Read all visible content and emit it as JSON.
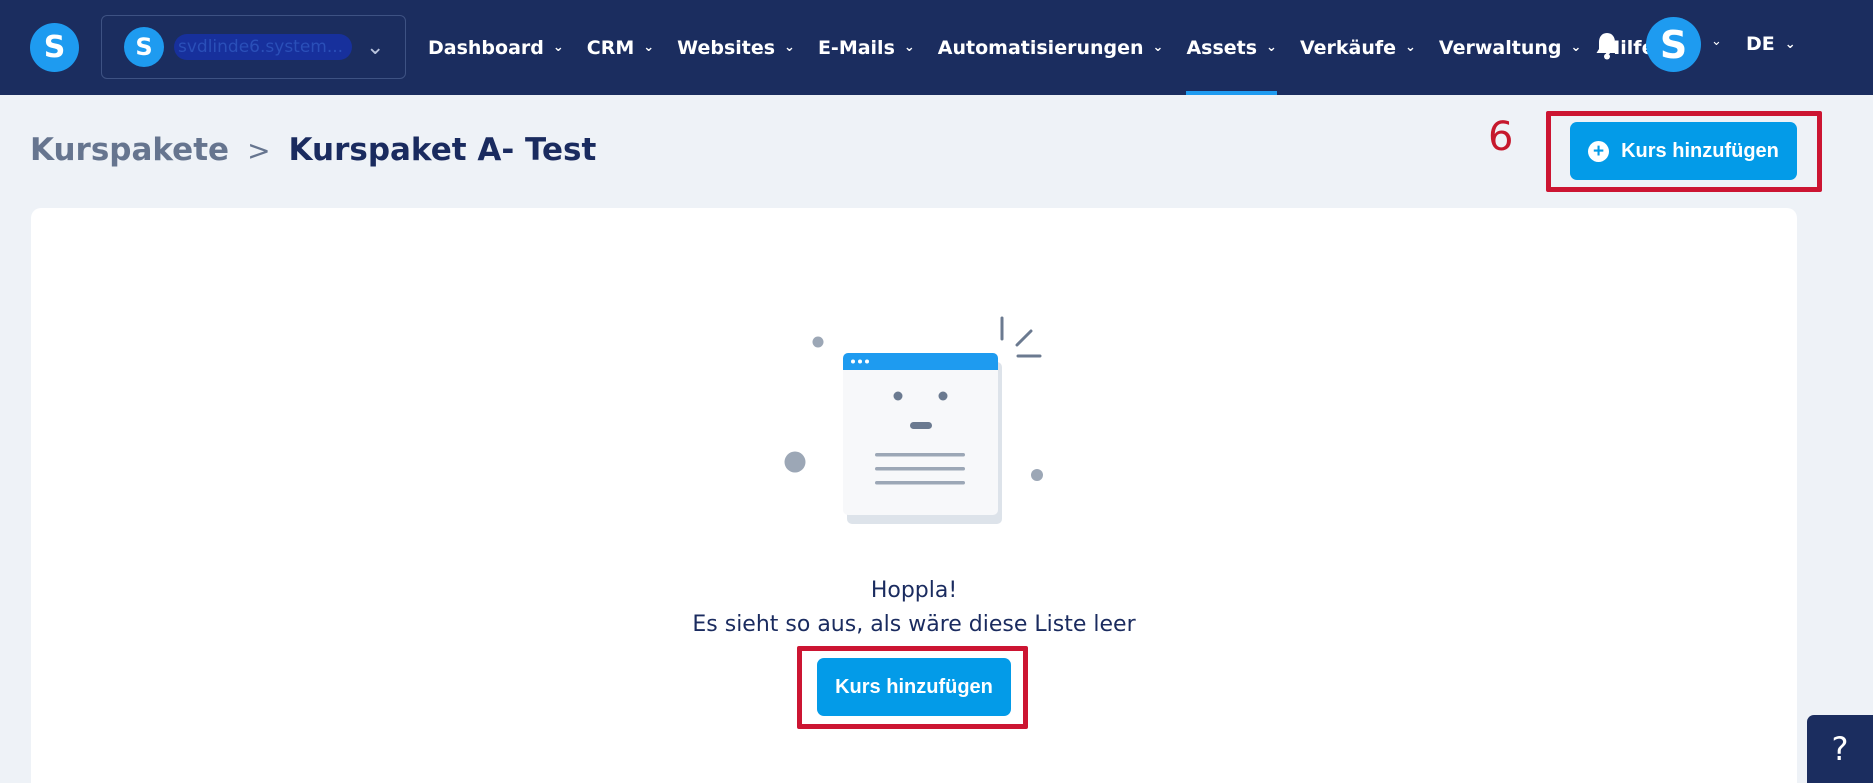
{
  "app": {
    "logo_letter": "S",
    "account_logo_letter": "S",
    "account_name": "svdlinde6.system..."
  },
  "nav": {
    "items": [
      {
        "label": "Dashboard",
        "has_dropdown": true,
        "active": false
      },
      {
        "label": "CRM",
        "has_dropdown": true,
        "active": false
      },
      {
        "label": "Websites",
        "has_dropdown": true,
        "active": false
      },
      {
        "label": "E-Mails",
        "has_dropdown": true,
        "active": false
      },
      {
        "label": "Automatisierungen",
        "has_dropdown": true,
        "active": false
      },
      {
        "label": "Assets",
        "has_dropdown": true,
        "active": true
      },
      {
        "label": "Verkäufe",
        "has_dropdown": true,
        "active": false
      },
      {
        "label": "Verwaltung",
        "has_dropdown": true,
        "active": false
      },
      {
        "label": "Hilfe",
        "has_dropdown": false,
        "active": false
      }
    ],
    "avatar_letter": "S",
    "language": "DE",
    "icons": [
      "bell-icon",
      "chevron-down-icon"
    ]
  },
  "breadcrumb": {
    "parent": "Kurspakete",
    "separator": ">",
    "current": "Kurspaket A- Test"
  },
  "annotation": {
    "step_number": "6",
    "highlight_color": "#cc1532"
  },
  "header_button": {
    "label": "Kurs hinzufügen",
    "icon": "plus-circle-icon"
  },
  "empty_state": {
    "title": "Hoppla!",
    "message": "Es sieht so aus, als wäre diese Liste leer",
    "button_label": "Kurs hinzufügen"
  },
  "help_button": {
    "label": "?"
  },
  "colors": {
    "nav_bg": "#1b2d5f",
    "accent": "#039be8",
    "page_bg": "#eef2f7",
    "highlight": "#cc1532"
  }
}
